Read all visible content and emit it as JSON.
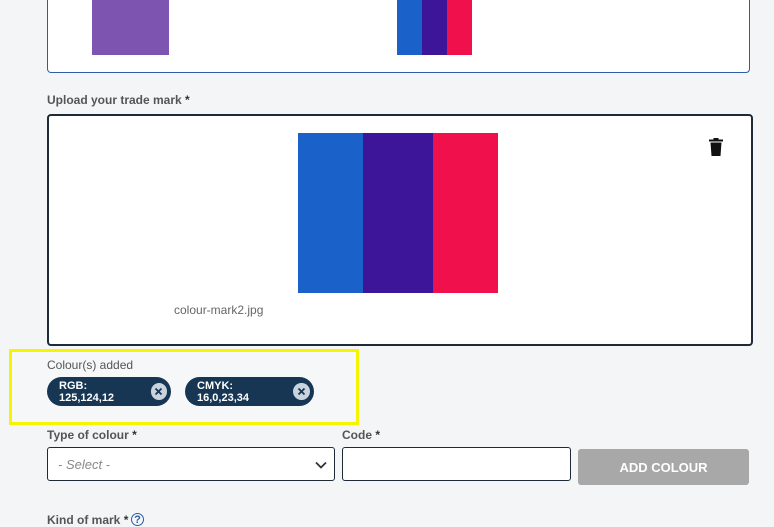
{
  "top_preview": {
    "swatch_color": "#7d55b0",
    "stripe_colors": [
      "#1a62c9",
      "#3c1598",
      "#f0114c"
    ]
  },
  "upload": {
    "label": "Upload your trade mark",
    "required_mark": "*",
    "stripe_colors": [
      "#1a62c9",
      "#3c1598",
      "#f0114c"
    ],
    "filename": "colour-mark2.jpg",
    "delete_icon": "trash-icon"
  },
  "colours_added": {
    "label": "Colour(s) added",
    "chips": [
      {
        "label": "RGB: 125,124,12"
      },
      {
        "label": "CMYK: 16,0,23,34"
      }
    ],
    "highlight_color": "#f5f500"
  },
  "type_of_colour": {
    "label": "Type of colour",
    "required_mark": "*",
    "selected": "- Select -"
  },
  "code": {
    "label": "Code",
    "required_mark": "*",
    "value": ""
  },
  "add_colour_button": {
    "label": "ADD COLOUR"
  },
  "kind_of_mark": {
    "label": "Kind of mark",
    "required_mark": "*",
    "help_icon": "question-circle-icon"
  },
  "colors": {
    "accent": "#2b5ea7",
    "chip_bg": "#163653",
    "button_disabled": "#a8a8a8"
  }
}
